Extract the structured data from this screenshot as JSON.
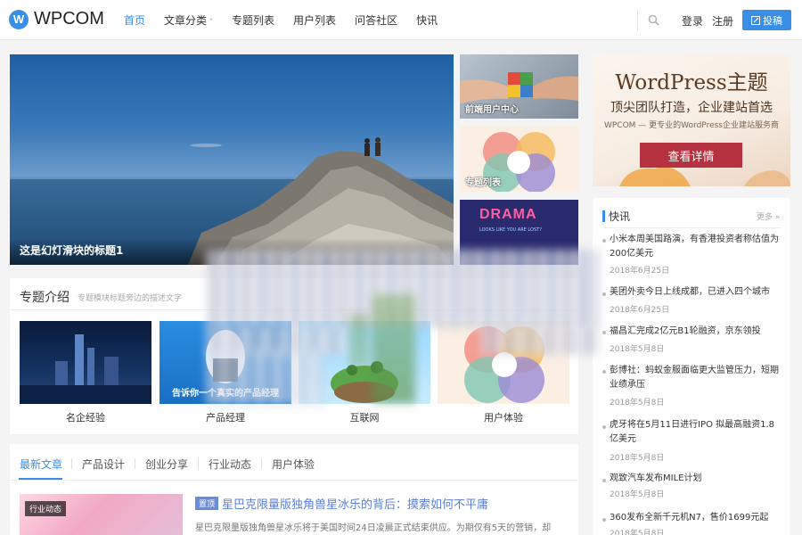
{
  "header": {
    "logo_mark": "W",
    "logo_text": "WPCOM",
    "nav": [
      {
        "label": "首页",
        "active": true
      },
      {
        "label": "文章分类",
        "has_caret": true
      },
      {
        "label": "专题列表"
      },
      {
        "label": "用户列表"
      },
      {
        "label": "问答社区"
      },
      {
        "label": "快讯"
      }
    ],
    "caret": "˅",
    "login": "登录",
    "register": "注册",
    "post_button": "投稿"
  },
  "slider": {
    "title": "这是幻灯滑块的标题1"
  },
  "thumbs": [
    {
      "label": "前端用户中心"
    },
    {
      "label": "专题列表"
    },
    {
      "label": "DRAMA",
      "sub": "LOOKS LIKE YOU ARE LOST?"
    }
  ],
  "banner": {
    "heading": "WordPress主题",
    "subheading": "顶尖团队打造，企业建站首选",
    "tagline": "WPCOM — 更专业的WordPress企业建站服务商",
    "button": "查看详情"
  },
  "topics": {
    "title": "专题介绍",
    "subtitle": "专题模块标题旁边的描述文字",
    "items": [
      {
        "label": "名企经验"
      },
      {
        "label": "产品经理",
        "overlay": "告诉你一个真实的产品经理"
      },
      {
        "label": "互联网"
      },
      {
        "label": "用户体验"
      }
    ]
  },
  "articles": {
    "tabs": [
      "最新文章",
      "产品设计",
      "创业分享",
      "行业动态",
      "用户体验"
    ],
    "first": {
      "image_tag": "行业动态",
      "badge": "置顶",
      "title": "星巴克限量版独角兽星冰乐的背后：摸索如何不平庸",
      "excerpt": "星巴克限量版独角兽星冰乐将于美国时间24日凌晨正式结束供应。为期仅有5天的营销，却"
    }
  },
  "kuaixun": {
    "title": "快讯",
    "more": "更多 »",
    "items": [
      {
        "title": "小米本周美国路演，有香港投资者称估值为200亿美元",
        "date": "2018年6月25日"
      },
      {
        "title": "美团外卖今日上线成都，已进入四个城市",
        "date": "2018年6月25日"
      },
      {
        "title": "福昌汇完成2亿元B1轮融资，京东领投",
        "date": "2018年5月8日"
      },
      {
        "title": "彭博社：蚂蚁金服面临更大监管压力，短期业绩承压",
        "date": "2018年5月8日"
      },
      {
        "title": "虎牙将在5月11日进行IPO 拟最高融资1.8亿美元",
        "date": "2018年5月8日"
      },
      {
        "title": "观致汽车发布MILE计划",
        "date": "2018年5月8日"
      },
      {
        "title": "360发布全新千元机N7，售价1699元起",
        "date": "2018年5月8日"
      }
    ]
  },
  "colors": {
    "accent": "#3a8ee6",
    "banner_button": "#b63240",
    "badge": "#6a8ddb"
  }
}
